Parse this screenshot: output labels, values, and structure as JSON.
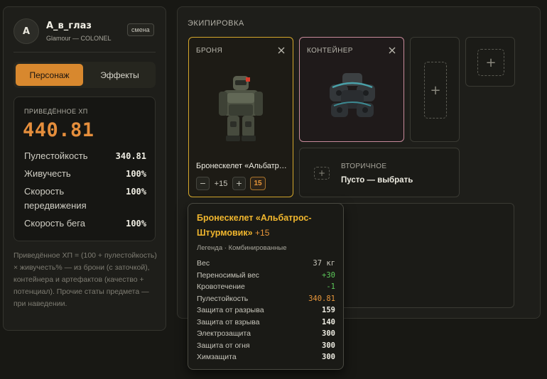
{
  "profile": {
    "avatar_letter": "A",
    "username": "А_в_глаз",
    "subtitle": "Glamour — COLONEL",
    "switch_label": "смена"
  },
  "tabs": [
    {
      "label": "Персонаж",
      "active": true
    },
    {
      "label": "Эффекты",
      "active": false
    }
  ],
  "stats": {
    "hp_label": "ПРИВЕДЁННОЕ ХП",
    "hp_value": "440.81",
    "rows": [
      {
        "label": "Пулестойкость",
        "value": "340.81"
      },
      {
        "label": "Живучесть",
        "value": "100%"
      },
      {
        "label": "Скорость передвижения",
        "value": "100%"
      },
      {
        "label": "Скорость бега",
        "value": "100%"
      }
    ]
  },
  "formula_note": "Приведённое ХП = (100 + пулестойкость) × живучесть% — из брони (с заточкой), контейнера и артефактов (качество + потенциал). Прочие статы предмета — при наведении.",
  "equipment": {
    "title": "ЭКИПИРОВКА",
    "armor": {
      "title": "БРОНЯ",
      "item_name": "Бронескелет «Альбатрос-Штурмовик»",
      "sharpen_value": "+15",
      "sharpen_badge": "15",
      "minus_label": "−",
      "plus_label": "+"
    },
    "container": {
      "title": "КОНТЕЙНЕР"
    },
    "secondary": {
      "title": "ВТОРИЧНОЕ",
      "action": "Пусто — выбрать"
    }
  },
  "tooltip": {
    "name": "Бронескелет «Альбатрос-Штурмовик»",
    "level": "+15",
    "rarity": "Легенда · Комбинированные",
    "rows": [
      {
        "label": "Вес",
        "value": "37 кг",
        "color": "#c8c6bc",
        "bold": false
      },
      {
        "label": "Переносимый вес",
        "value": "+30",
        "color": "#5cc85a",
        "bold": false
      },
      {
        "label": "Кровотечение",
        "value": "-1",
        "color": "#5cc85a",
        "bold": false
      },
      {
        "label": "Пулестойкость",
        "value": "340.81",
        "color": "#e8963a",
        "bold": false
      },
      {
        "label": "Защита от разрыва",
        "value": "159",
        "color": "#eeece2",
        "bold": true
      },
      {
        "label": "Защита от взрыва",
        "value": "140",
        "color": "#eeece2",
        "bold": true
      },
      {
        "label": "Электрозащита",
        "value": "300",
        "color": "#eeece2",
        "bold": true
      },
      {
        "label": "Защита от огня",
        "value": "300",
        "color": "#eeece2",
        "bold": true
      },
      {
        "label": "Химзащита",
        "value": "300",
        "color": "#eeece2",
        "bold": true
      }
    ]
  },
  "colors": {
    "accent": "#d8882e",
    "hp": "#e58e3c",
    "armor_border": "#d4a72c",
    "container_border": "#c88a9a",
    "legend_name": "#f0b62e"
  }
}
